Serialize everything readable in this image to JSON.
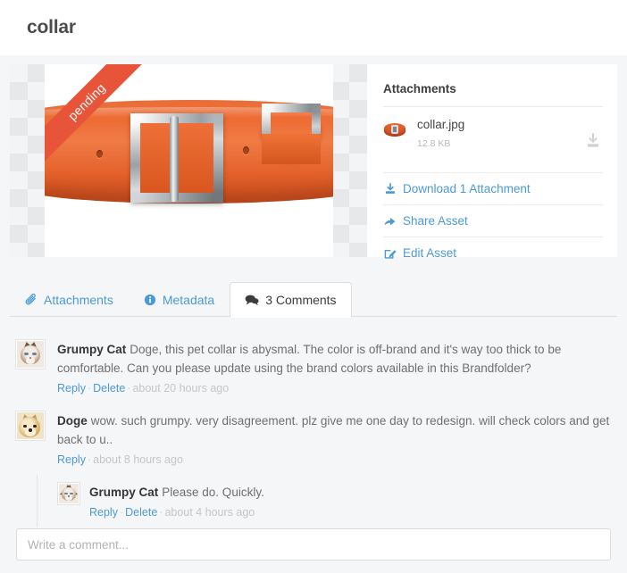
{
  "header": {
    "title": "collar"
  },
  "preview": {
    "ribbon_label": "pending",
    "image_alt": "orange pet collar with silver buckle and D-ring"
  },
  "attachments_panel": {
    "title": "Attachments",
    "items": [
      {
        "name": "collar.jpg",
        "size": "12.8 KB",
        "thumb_icon": "collar-thumbnail",
        "download_icon": "download-icon"
      }
    ],
    "actions": [
      {
        "label": "Download 1 Attachment",
        "icon": "download-icon"
      },
      {
        "label": "Share Asset",
        "icon": "share-arrow-icon"
      },
      {
        "label": "Edit Asset",
        "icon": "edit-pencil-icon"
      }
    ]
  },
  "tabs": [
    {
      "label": "Attachments",
      "icon": "paperclip-icon",
      "active": false
    },
    {
      "label": "Metadata",
      "icon": "info-circle-icon",
      "active": false
    },
    {
      "label": "3 Comments",
      "icon": "comment-bubbles-icon",
      "active": true
    }
  ],
  "comments": [
    {
      "author": "Grumpy Cat",
      "avatar": "grumpy-cat-avatar",
      "text": "Doge, this pet collar is abysmal. The color is off-brand and it's way too thick to be comfortable. Can you please update using the brand colors available in this Brandfolder?",
      "reply_label": "Reply",
      "delete_label": "Delete",
      "timestamp": "about 20 hours ago",
      "nested": false
    },
    {
      "author": "Doge",
      "avatar": "doge-avatar",
      "text": "wow. such grumpy. very disagreement. plz give me one day to redesign. will check colors and get back to u..",
      "reply_label": "Reply",
      "delete_label": null,
      "timestamp": "about 8 hours ago",
      "nested": false
    },
    {
      "author": "Grumpy Cat",
      "avatar": "grumpy-cat-avatar",
      "text": "Please do. Quickly.",
      "reply_label": "Reply",
      "delete_label": "Delete",
      "timestamp": "about 4 hours ago",
      "nested": true
    }
  ],
  "comment_box": {
    "placeholder": "Write a comment...",
    "value": ""
  },
  "colors": {
    "link": "#4c9ad4",
    "ribbon": "#e8543a",
    "accent_orange": "#ee6b33",
    "page_bg": "#f5f6f8",
    "text": "#6d6f71"
  }
}
